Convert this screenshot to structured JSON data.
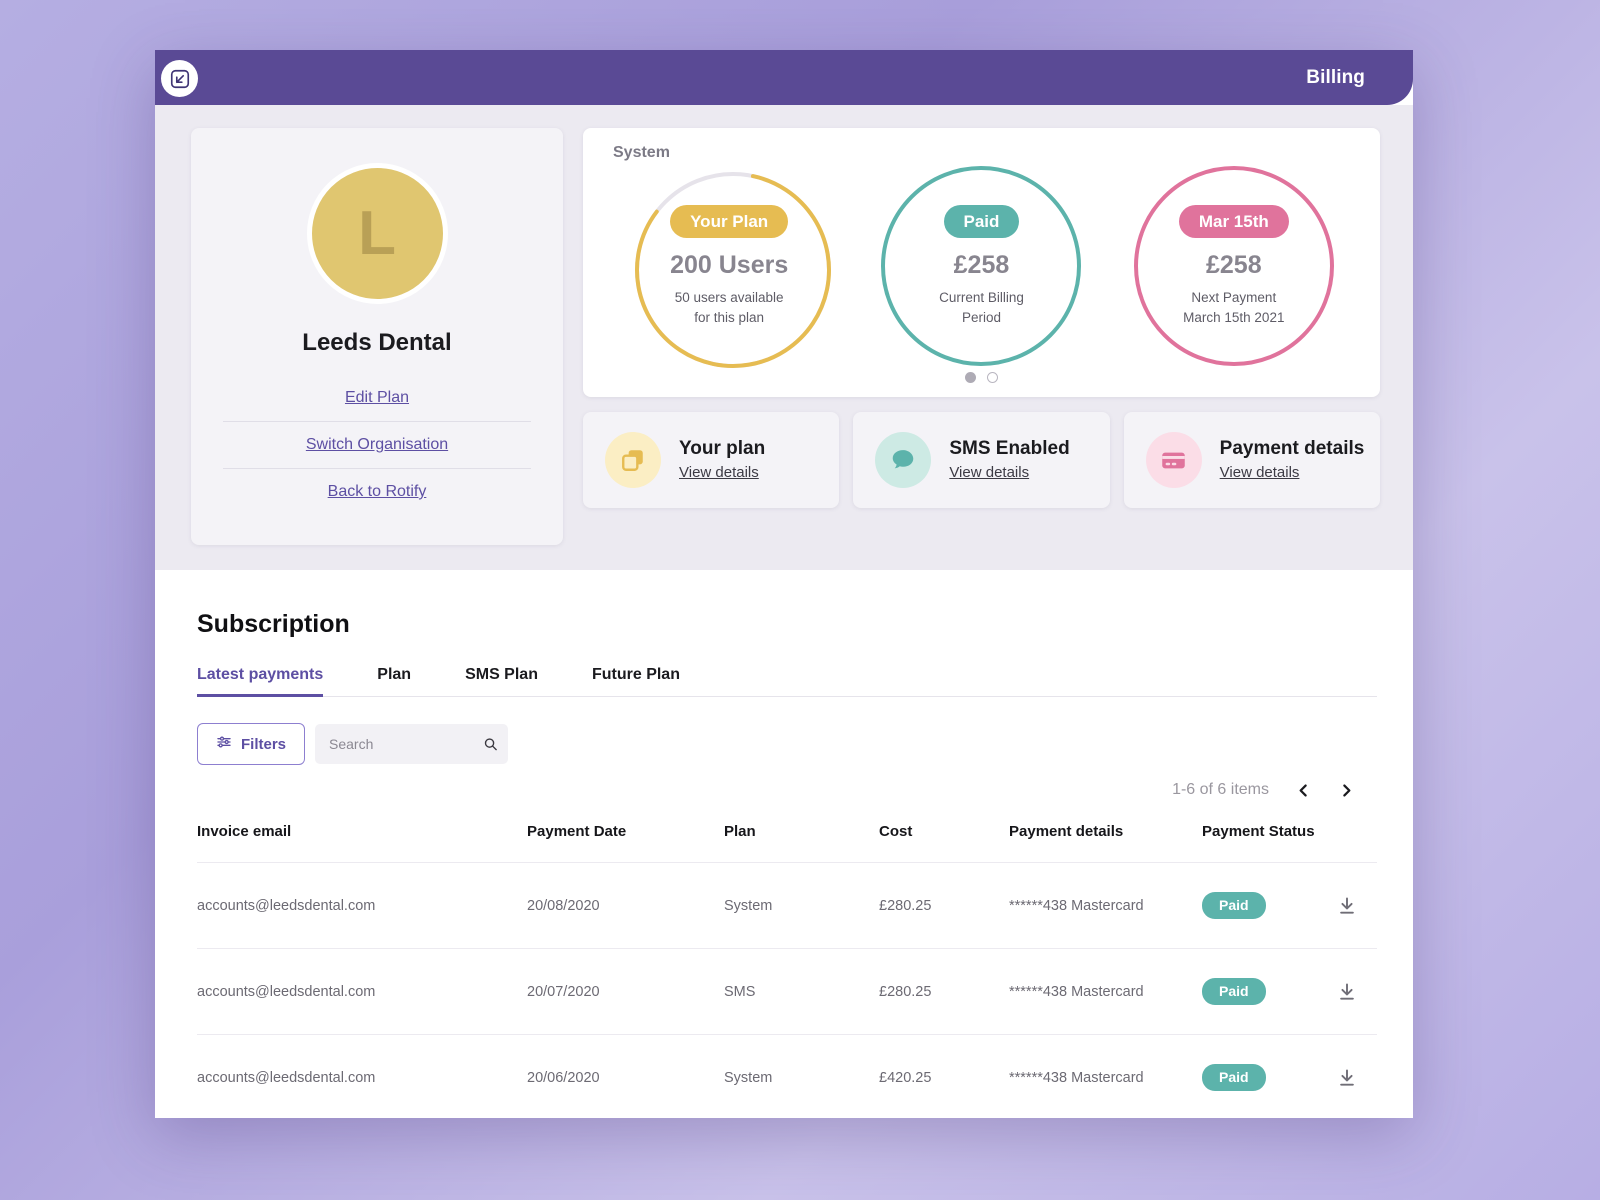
{
  "header": {
    "title": "Billing",
    "logo_icon": "rotify-arrow-logo-icon"
  },
  "profile": {
    "avatar_initial": "L",
    "org_name": "Leeds Dental",
    "links": [
      {
        "label": "Edit Plan"
      },
      {
        "label": "Switch Organisation"
      },
      {
        "label": "Back to Rotify"
      }
    ]
  },
  "stats": {
    "section_label": "System",
    "rings": [
      {
        "pill": "Your Plan",
        "value": "200 Users",
        "sub_line1": "50 users available",
        "sub_line2": "for this plan",
        "color": "#e6bc52",
        "track_color": "#e6e3ea",
        "progress_percent": 82,
        "style": "progress"
      },
      {
        "pill": "Paid",
        "value": "£258",
        "sub_line1": "Current Billing",
        "sub_line2": "Period",
        "color": "#5cb3ab",
        "style": "solid"
      },
      {
        "pill": "Mar 15th",
        "value": "£258",
        "sub_line1": "Next Payment",
        "sub_line2": "March 15th 2021",
        "color": "#e0739c",
        "style": "solid"
      }
    ],
    "carousel": {
      "total": 2,
      "active_index": 0
    }
  },
  "info_cards": [
    {
      "title": "Your plan",
      "link": "View details",
      "icon": "copy-layers-icon",
      "icon_bg": "#fbeec4",
      "icon_color": "#e6bc52"
    },
    {
      "title": "SMS Enabled",
      "link": "View details",
      "icon": "chat-bubble-icon",
      "icon_bg": "#cdeae4",
      "icon_color": "#5cb3ab"
    },
    {
      "title": "Payment details",
      "link": "View details",
      "icon": "credit-card-icon",
      "icon_bg": "#fbdde7",
      "icon_color": "#e0739c"
    }
  ],
  "subscription": {
    "title": "Subscription",
    "tabs": [
      {
        "label": "Latest payments",
        "active": true
      },
      {
        "label": "Plan",
        "active": false
      },
      {
        "label": "SMS Plan",
        "active": false
      },
      {
        "label": "Future Plan",
        "active": false
      }
    ],
    "toolbar": {
      "filters_label": "Filters",
      "filters_icon": "sliders-icon",
      "search_value": "",
      "search_placeholder": "Search",
      "search_icon": "search-icon"
    },
    "pagination": {
      "info": "1-6 of 6 items",
      "prev_icon": "chevron-left-icon",
      "next_icon": "chevron-right-icon"
    },
    "table": {
      "columns": [
        "Invoice email",
        "Payment Date",
        "Plan",
        "Cost",
        "Payment details",
        "Payment Status"
      ],
      "rows": [
        {
          "email": "accounts@leedsdental.com",
          "date": "20/08/2020",
          "plan": "System",
          "cost": "£280.25",
          "payment_details": "******438  Mastercard",
          "status": "Paid",
          "download_icon": "download-icon"
        },
        {
          "email": "accounts@leedsdental.com",
          "date": "20/07/2020",
          "plan": "SMS",
          "cost": "£280.25",
          "payment_details": "******438  Mastercard",
          "status": "Paid",
          "download_icon": "download-icon"
        },
        {
          "email": "accounts@leedsdental.com",
          "date": "20/06/2020",
          "plan": "System",
          "cost": "£420.25",
          "payment_details": "******438  Mastercard",
          "status": "Paid",
          "download_icon": "download-icon"
        }
      ]
    }
  },
  "colors": {
    "brand_purple": "#5a4a95",
    "accent_purple": "#5d4fa3",
    "yellow": "#e6bc52",
    "teal": "#5cb3ab",
    "pink": "#e0739c",
    "page_bg": "#b5aee2"
  }
}
